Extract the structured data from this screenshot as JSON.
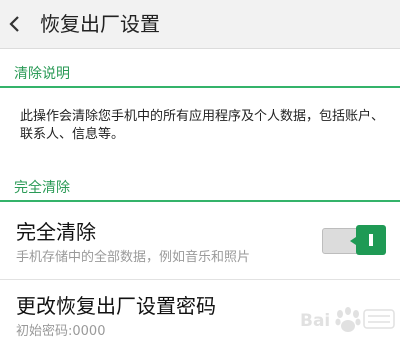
{
  "header": {
    "title": "恢复出厂设置",
    "back_icon": "chevron-left-icon"
  },
  "sections": [
    {
      "header": "清除说明",
      "description": "此操作会清除您手机中的所有应用程序及个人数据，包括账户、联系人、信息等。"
    },
    {
      "header": "完全清除"
    }
  ],
  "rows": [
    {
      "title": "完全清除",
      "subtitle": "手机存储中的全部数据，例如音乐和照片",
      "toggle_on": true
    },
    {
      "title": "更改恢复出厂设置密码",
      "subtitle": "初始密码:0000"
    }
  ],
  "colors": {
    "accent": "#2a9a56",
    "accent_line": "#34b36a",
    "toggle_on": "#1f9a55",
    "header_bg": "#f2f2f2",
    "subtitle": "#9a9a9a"
  },
  "watermark": {
    "logo": "baidu-jingyan-logo",
    "text": "Baidu"
  }
}
